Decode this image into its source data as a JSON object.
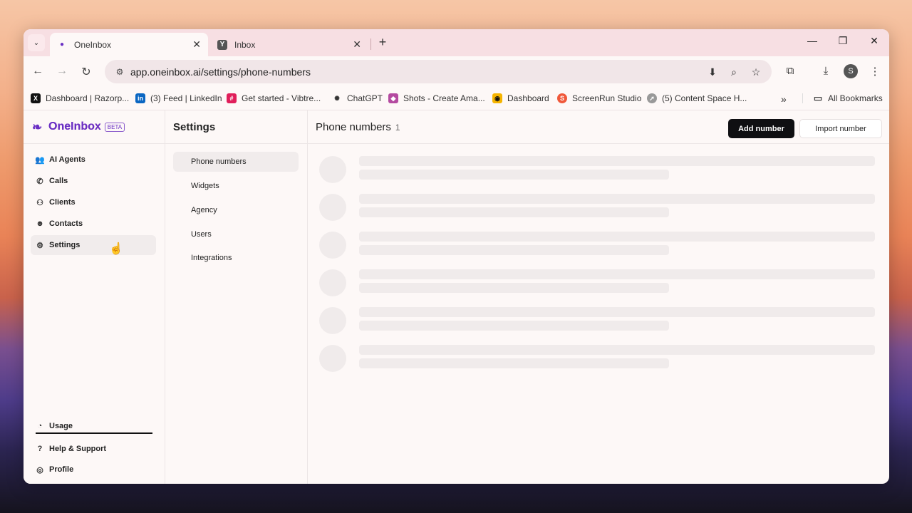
{
  "browser": {
    "tabs": [
      {
        "title": "OneInbox",
        "icon": "oneinbox-logo-icon",
        "active": true
      },
      {
        "title": "Inbox",
        "icon": "y-logo-icon",
        "active": false
      }
    ],
    "url": "app.oneinbox.ai/settings/phone-numbers",
    "profile_initial": "S",
    "bookmarks": [
      {
        "label": "Dashboard | Razorp...",
        "icon": "x-logo-icon"
      },
      {
        "label": "(3) Feed | LinkedIn",
        "icon": "linkedin-icon"
      },
      {
        "label": "Get started - Vibtre...",
        "icon": "slack-icon"
      },
      {
        "label": "ChatGPT",
        "icon": "openai-icon"
      },
      {
        "label": "Shots - Create Ama...",
        "icon": "shots-icon"
      },
      {
        "label": "Dashboard",
        "icon": "dashboard-icon"
      },
      {
        "label": "ScreenRun Studio",
        "icon": "screenrun-icon"
      },
      {
        "label": "(5) Content Space H...",
        "icon": "compass-icon"
      }
    ],
    "all_bookmarks": "All Bookmarks"
  },
  "app": {
    "name": "OneInbox",
    "badge": "BETA",
    "nav": [
      {
        "label": "AI Agents",
        "icon": "agents-icon"
      },
      {
        "label": "Calls",
        "icon": "phone-icon"
      },
      {
        "label": "Clients",
        "icon": "clients-icon"
      },
      {
        "label": "Contacts",
        "icon": "contact-icon"
      },
      {
        "label": "Settings",
        "icon": "gear-icon",
        "active": true
      }
    ],
    "footer_nav": [
      {
        "label": "Usage",
        "icon": "usage-icon"
      },
      {
        "label": "Help & Support",
        "icon": "help-icon"
      },
      {
        "label": "Profile",
        "icon": "profile-icon"
      }
    ]
  },
  "settings": {
    "title": "Settings",
    "items": [
      {
        "label": "Phone numbers",
        "active": true
      },
      {
        "label": "Widgets"
      },
      {
        "label": "Agency"
      },
      {
        "label": "Users"
      },
      {
        "label": "Integrations"
      }
    ]
  },
  "main": {
    "title": "Phone numbers",
    "count": "1",
    "add_button": "Add number",
    "import_button": "Import number"
  }
}
